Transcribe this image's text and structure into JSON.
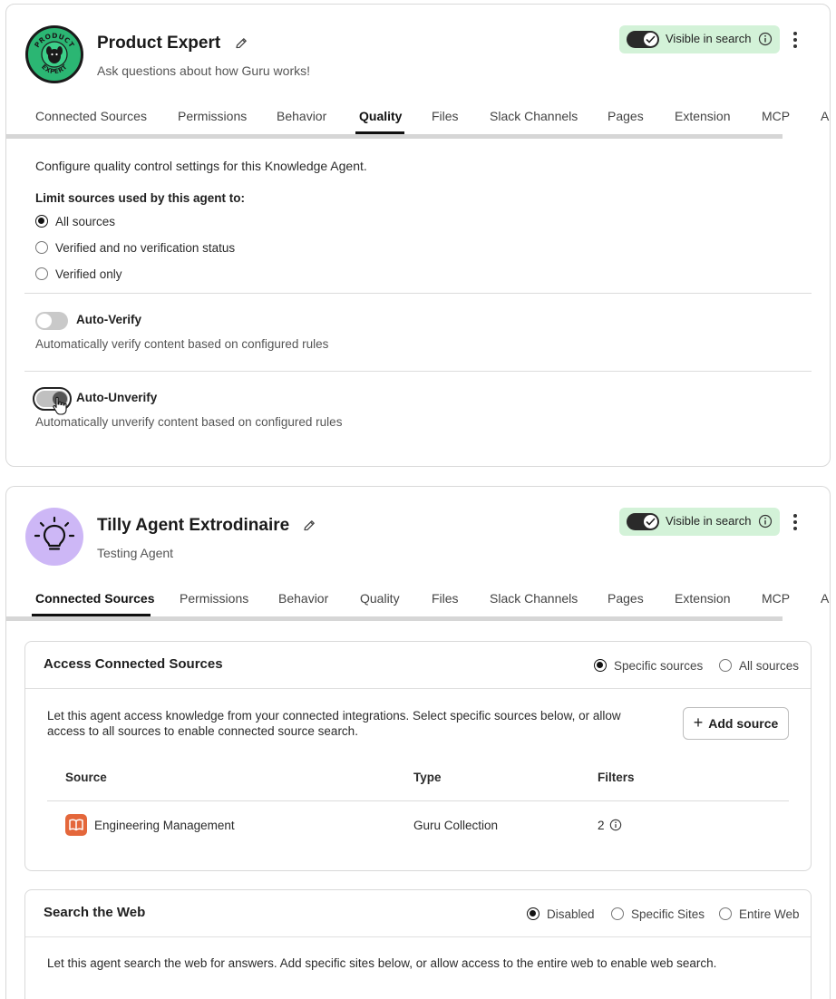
{
  "agent1": {
    "title": "Product Expert",
    "subtitle": "Ask questions about how Guru works!",
    "avatar_icon": "product-expert-badge-icon",
    "avatar_text_top": "PRODUCT",
    "avatar_text_bottom": "EXPERT",
    "visible_label": "Visible in search",
    "visible_on": true,
    "tabs": [
      "Connected Sources",
      "Permissions",
      "Behavior",
      "Quality",
      "Files",
      "Slack Channels",
      "Pages",
      "Extension",
      "MCP",
      "A"
    ],
    "active_tab": "Quality",
    "quality": {
      "description": "Configure quality control settings for this Knowledge Agent.",
      "limit_label": "Limit sources used by this agent to:",
      "options": [
        "All sources",
        "Verified and no verification status",
        "Verified only"
      ],
      "selected_option": "All sources",
      "auto_verify": {
        "title": "Auto-Verify",
        "description": "Automatically verify content based on configured rules",
        "on": false
      },
      "auto_unverify": {
        "title": "Auto-Unverify",
        "description": "Automatically unverify content based on configured rules",
        "on": false
      }
    }
  },
  "agent2": {
    "title": "Tilly Agent Extrodinaire",
    "subtitle": "Testing Agent",
    "avatar_icon": "lightbulb-icon",
    "visible_label": "Visible in search",
    "visible_on": true,
    "tabs": [
      "Connected Sources",
      "Permissions",
      "Behavior",
      "Quality",
      "Files",
      "Slack Channels",
      "Pages",
      "Extension",
      "MCP",
      "A"
    ],
    "active_tab": "Connected Sources",
    "access": {
      "title": "Access Connected Sources",
      "options": [
        "Specific sources",
        "All sources"
      ],
      "selected_option": "Specific sources",
      "description_line1": "Let this agent access knowledge from your connected integrations. Select specific sources below, or allow",
      "description_line2": "access to all sources to enable connected source search.",
      "add_button": "Add source",
      "columns": [
        "Source",
        "Type",
        "Filters"
      ],
      "rows": [
        {
          "source": "Engineering Management",
          "type": "Guru Collection",
          "filters": "2",
          "icon": "book-icon"
        }
      ]
    },
    "web": {
      "title": "Search the Web",
      "options": [
        "Disabled",
        "Specific Sites",
        "Entire Web"
      ],
      "selected_option": "Disabled",
      "description": "Let this agent search the web for answers. Add specific sites below, or allow access to the entire web to enable web search."
    }
  },
  "colors": {
    "visible_pill": "#d3f2d8",
    "guru_green": "#2bb673",
    "bulb_purple": "#cdb7f6",
    "source_icon": "#e4673b"
  }
}
